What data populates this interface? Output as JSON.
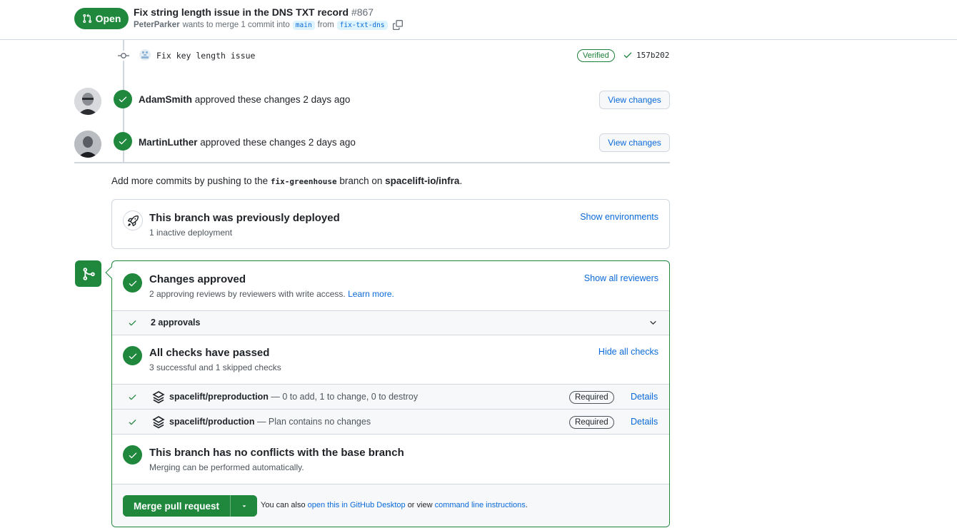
{
  "header": {
    "state_label": "Open",
    "title": "Fix string length issue in the DNS TXT record",
    "number": "#867",
    "author": "PeterParker",
    "merge_text_1": "wants to merge 1 commit into",
    "base_branch": "main",
    "merge_text_2": "from",
    "head_branch": "fix-txt-dns"
  },
  "commit": {
    "message": "Fix key length issue",
    "verified_label": "Verified",
    "sha": "157b202"
  },
  "reviews": [
    {
      "user": "AdamSmith",
      "text": "approved these changes 2 days ago",
      "button": "View changes"
    },
    {
      "user": "MartinLuther",
      "text": "approved these changes 2 days ago",
      "button": "View changes"
    }
  ],
  "add_commits": {
    "prefix": "Add more commits by pushing to the",
    "branch": "fix-greenhouse",
    "middle": "branch on",
    "repo": "spacelift-io/infra",
    "suffix": "."
  },
  "deploy": {
    "title": "This branch was previously deployed",
    "subtitle": "1 inactive deployment",
    "link": "Show environments"
  },
  "merge_box": {
    "approved_title": "Changes approved",
    "approved_sub": "2 approving reviews by reviewers with write access.",
    "learn_more": "Learn more.",
    "show_reviewers": "Show all reviewers",
    "approvals_label": "2 approvals",
    "checks_title": "All checks have passed",
    "checks_sub": "3 successful and 1 skipped checks",
    "hide_checks": "Hide all checks",
    "checks": [
      {
        "name": "spacelift/preproduction",
        "desc": "— 0 to add, 1 to change, 0 to destroy",
        "required": "Required",
        "details": "Details"
      },
      {
        "name": "spacelift/production",
        "desc": "— Plan contains no changes",
        "required": "Required",
        "details": "Details"
      }
    ],
    "conflicts_title": "This branch has no conflicts with the base branch",
    "conflicts_sub": "Merging can be performed automatically.",
    "merge_button": "Merge pull request",
    "hint_prefix": "You can also",
    "hint_link1": "open this in GitHub Desktop",
    "hint_middle": "or view",
    "hint_link2": "command line instructions",
    "hint_suffix": "."
  },
  "colors": {
    "success": "#1f883d",
    "link": "#0969da",
    "border": "#d0d7de"
  }
}
